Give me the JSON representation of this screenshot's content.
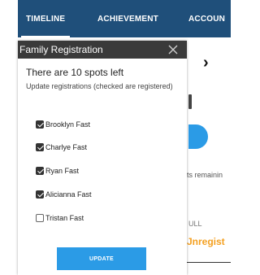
{
  "tabs": [
    {
      "label": "TIMELINE"
    },
    {
      "label": "ACHIEVEMENT"
    },
    {
      "label": "ACCOUN"
    }
  ],
  "background": {
    "partial_text_1": "ts remainin",
    "partial_text_2": "ULL",
    "partial_text_3": "Jnregist"
  },
  "modal": {
    "title": "Family Registration",
    "spots": "There are 10 spots left",
    "instructions": "Update registrations (checked are registered)",
    "registrants": [
      {
        "name": "Brooklyn Fast",
        "checked": true
      },
      {
        "name": "Charlye Fast",
        "checked": true
      },
      {
        "name": "Ryan Fast",
        "checked": true
      },
      {
        "name": "Alicianna Fast",
        "checked": true
      },
      {
        "name": "Tristan Fast",
        "checked": false
      }
    ],
    "update_label": "UPDATE"
  },
  "colors": {
    "topbar": "#1f4f7a",
    "modal_header": "#3a3a3a",
    "button": "#2b9be6",
    "status_orange": "#f4a020"
  }
}
